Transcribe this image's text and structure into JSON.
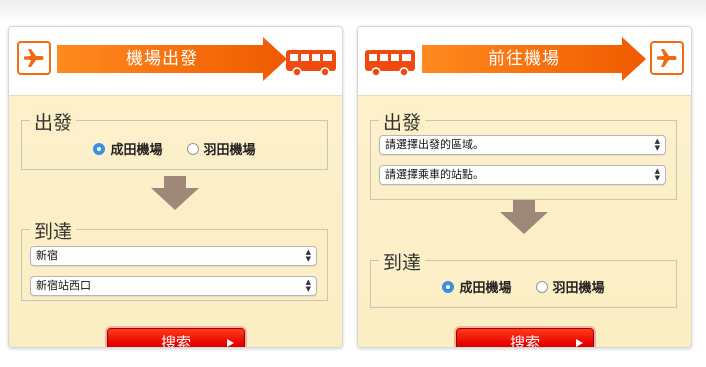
{
  "colors": {
    "accent": "#f06a10",
    "panel_bg": "#fdf0c8",
    "button": "#e60000",
    "radio_selected": "#3a8ee6"
  },
  "left_panel": {
    "banner_title": "機場出發",
    "start_icon": "airplane-icon",
    "end_icon": "bus-icon",
    "departure_legend": "出發",
    "departure_options": [
      {
        "label": "成田機場",
        "selected": true
      },
      {
        "label": "羽田機場",
        "selected": false
      }
    ],
    "arrival_legend": "到達",
    "area_select_value": "新宿",
    "stop_select_value": "新宿站西口",
    "search_label": "搜索"
  },
  "right_panel": {
    "banner_title": "前往機場",
    "start_icon": "bus-icon",
    "end_icon": "airplane-icon",
    "departure_legend": "出發",
    "area_select_value": "請選擇出發的區域。",
    "stop_select_value": "請選擇乘車的站點。",
    "arrival_legend": "到達",
    "arrival_options": [
      {
        "label": "成田機場",
        "selected": true
      },
      {
        "label": "羽田機場",
        "selected": false
      }
    ],
    "search_label": "搜索"
  }
}
